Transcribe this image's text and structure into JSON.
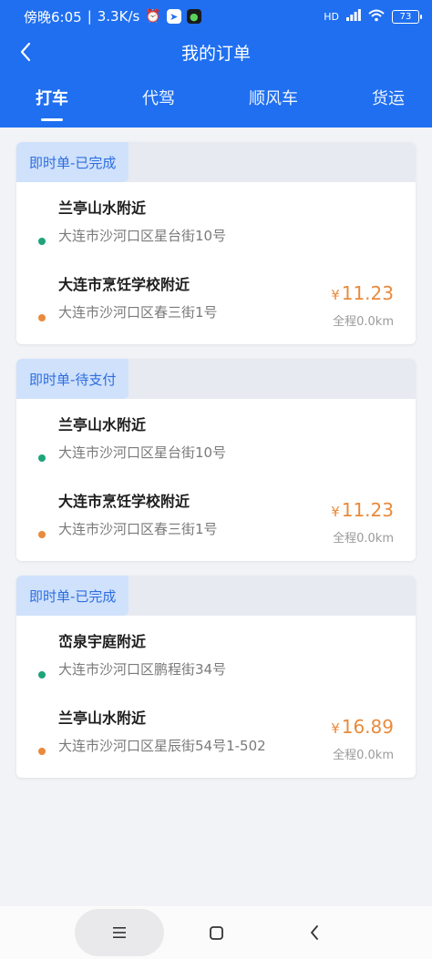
{
  "status_bar": {
    "time_text": "傍晚6:05",
    "speed_text": "3.3K/s",
    "signal_text": "HD",
    "battery": "73"
  },
  "header": {
    "title": "我的订单",
    "back_icon": "chevron-left-icon"
  },
  "tabs": [
    {
      "label": "打车",
      "active": true
    },
    {
      "label": "代驾",
      "active": false
    },
    {
      "label": "顺风车",
      "active": false
    },
    {
      "label": "货运",
      "active": false
    }
  ],
  "orders": [
    {
      "status": "即时单-已完成",
      "from": {
        "name": "兰亭山水附近",
        "address": "大连市沙河口区星台街10号"
      },
      "to": {
        "name": "大连市烹饪学校附近",
        "address": "大连市沙河口区春三街1号"
      },
      "currency": "¥",
      "price": "11.23",
      "distance": "全程0.0km"
    },
    {
      "status": "即时单-待支付",
      "from": {
        "name": "兰亭山水附近",
        "address": "大连市沙河口区星台街10号"
      },
      "to": {
        "name": "大连市烹饪学校附近",
        "address": "大连市沙河口区春三街1号"
      },
      "currency": "¥",
      "price": "11.23",
      "distance": "全程0.0km"
    },
    {
      "status": "即时单-已完成",
      "from": {
        "name": "峦泉宇庭附近",
        "address": "大连市沙河口区鹏程街34号"
      },
      "to": {
        "name": "兰亭山水附近",
        "address": "大连市沙河口区星辰街54号1-502"
      },
      "currency": "¥",
      "price": "16.89",
      "distance": "全程0.0km"
    }
  ],
  "colors": {
    "header_bg": "#1f6ff0",
    "start_dot": "#1ea37a",
    "end_dot": "#e98a3c",
    "price": "#e98a3c",
    "badge_text": "#2d6ee0"
  }
}
